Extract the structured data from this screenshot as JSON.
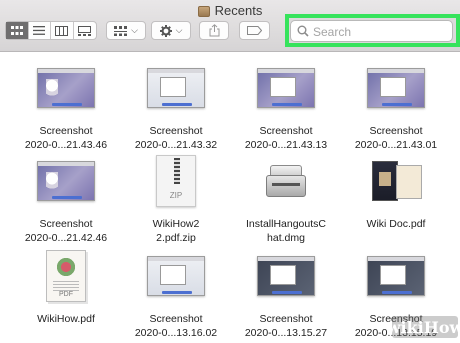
{
  "window": {
    "title": "Recents",
    "title_icon": "folder-icon"
  },
  "toolbar": {
    "view_buttons": [
      {
        "name": "icon-view",
        "icon": "grid-icon",
        "active": true
      },
      {
        "name": "list-view",
        "icon": "list-icon",
        "active": false
      },
      {
        "name": "column-view",
        "icon": "columns-icon",
        "active": false
      },
      {
        "name": "gallery-view",
        "icon": "gallery-icon",
        "active": false
      }
    ],
    "group_icon": "group-by-icon",
    "action_icon": "gear-icon",
    "share_icon": "share-icon",
    "tag_icon": "tag-icon"
  },
  "search": {
    "placeholder": "Search",
    "icon": "search-icon",
    "highlight_color": "#36e35c"
  },
  "files": [
    {
      "name_line1": "Screenshot",
      "name_line2": "2020-0...21.43.46",
      "kind": "screenshot"
    },
    {
      "name_line1": "Screenshot",
      "name_line2": "2020-0...21.43.32",
      "kind": "screenshot"
    },
    {
      "name_line1": "Screenshot",
      "name_line2": "2020-0...21.43.13",
      "kind": "screenshot"
    },
    {
      "name_line1": "Screenshot",
      "name_line2": "2020-0...21.43.01",
      "kind": "screenshot"
    },
    {
      "name_line1": "Screenshot",
      "name_line2": "2020-0...21.42.46",
      "kind": "screenshot"
    },
    {
      "name_line1": "WikiHow2",
      "name_line2": "2.pdf.zip",
      "kind": "zip",
      "icon_label": "ZIP"
    },
    {
      "name_line1": "InstallHangoutsC",
      "name_line2": "hat.dmg",
      "kind": "dmg"
    },
    {
      "name_line1": "Wiki Doc.pdf",
      "name_line2": "",
      "kind": "pdf"
    },
    {
      "name_line1": "WikiHow.pdf",
      "name_line2": "",
      "kind": "pdf",
      "icon_label": "PDF"
    },
    {
      "name_line1": "Screenshot",
      "name_line2": "2020-0...13.16.02",
      "kind": "screenshot"
    },
    {
      "name_line1": "Screenshot",
      "name_line2": "2020-0...13.15.27",
      "kind": "screenshot"
    },
    {
      "name_line1": "Screenshot",
      "name_line2": "2020-0...13.15.19",
      "kind": "screenshot"
    }
  ],
  "watermark": "wikiHow"
}
